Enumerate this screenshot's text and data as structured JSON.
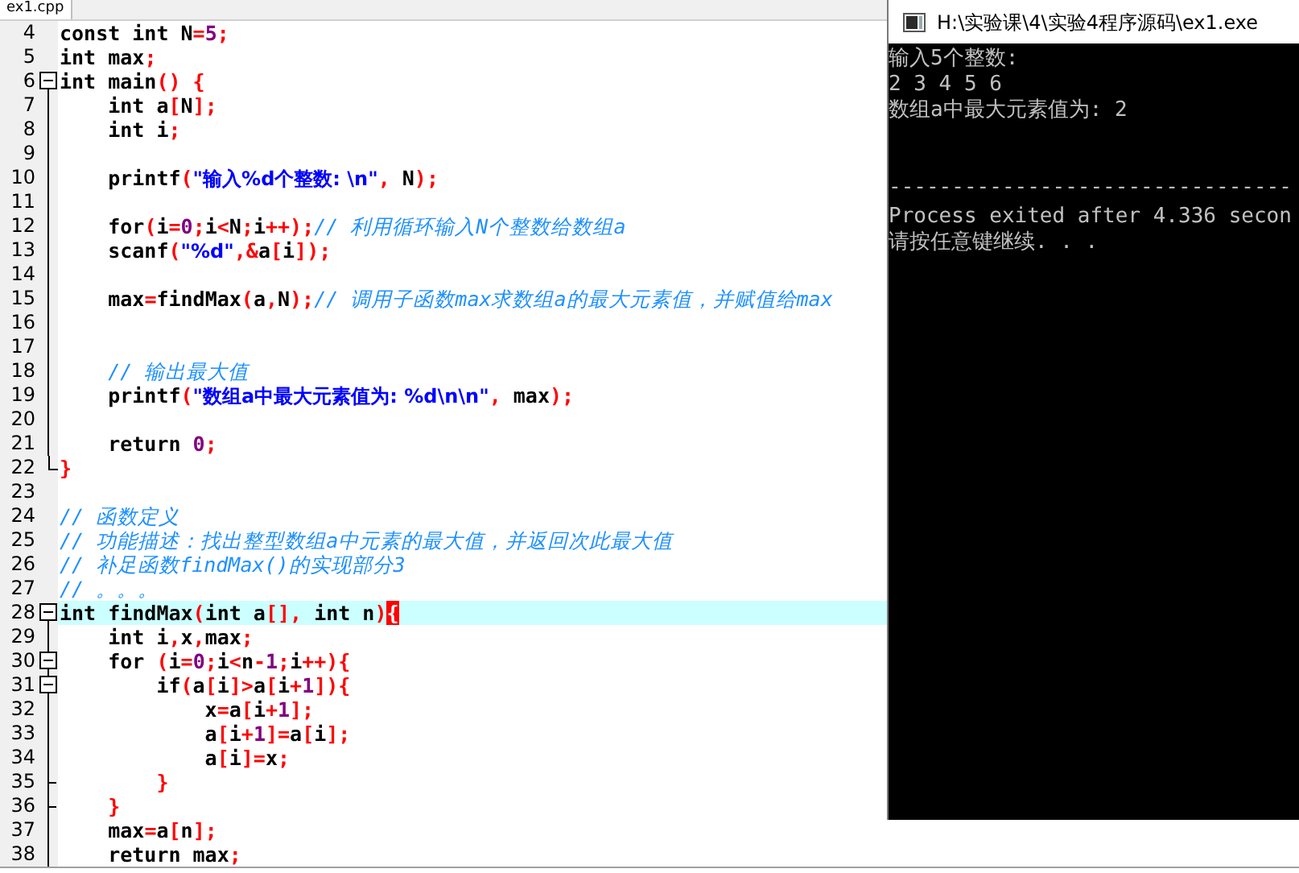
{
  "editor": {
    "tab": {
      "label": "ex1.cpp",
      "selected": true
    },
    "lines": [
      {
        "number": "4",
        "kind": "plain",
        "current": false,
        "tokens": [
          {
            "kind": "code",
            "text": "const int N"
          },
          {
            "kind": "sym",
            "text": "="
          },
          {
            "kind": "num",
            "text": "5"
          },
          {
            "kind": "sym",
            "text": ";"
          }
        ]
      },
      {
        "number": "5",
        "kind": "plain",
        "current": false,
        "tokens": [
          {
            "kind": "code",
            "text": "int max"
          },
          {
            "kind": "sym",
            "text": ";"
          }
        ]
      },
      {
        "number": "6",
        "kind": "fold",
        "current": false,
        "tokens": [
          {
            "kind": "code",
            "text": "int main"
          },
          {
            "kind": "sym",
            "text": "() {"
          }
        ]
      },
      {
        "number": "7",
        "kind": "body",
        "current": false,
        "tokens": [
          {
            "kind": "code",
            "text": "    int a"
          },
          {
            "kind": "sym",
            "text": "["
          },
          {
            "kind": "code",
            "text": "N"
          },
          {
            "kind": "sym",
            "text": "];"
          }
        ]
      },
      {
        "number": "8",
        "kind": "body",
        "current": false,
        "tokens": [
          {
            "kind": "code",
            "text": "    int i"
          },
          {
            "kind": "sym",
            "text": ";"
          }
        ]
      },
      {
        "number": "9",
        "kind": "body",
        "current": false
      },
      {
        "number": "10",
        "kind": "body",
        "current": false,
        "tokens": [
          {
            "kind": "code",
            "text": "    printf"
          },
          {
            "kind": "sym",
            "text": "("
          },
          {
            "kind": "str",
            "text": "\"输入%d个整数: \\n\""
          },
          {
            "kind": "sym",
            "text": ", "
          },
          {
            "kind": "code",
            "text": "N"
          },
          {
            "kind": "sym",
            "text": ");"
          }
        ]
      },
      {
        "number": "11",
        "kind": "body",
        "current": false
      },
      {
        "number": "12",
        "kind": "body",
        "current": false,
        "tokens": [
          {
            "kind": "code",
            "text": "    for"
          },
          {
            "kind": "sym",
            "text": "("
          },
          {
            "kind": "code",
            "text": "i"
          },
          {
            "kind": "sym",
            "text": "="
          },
          {
            "kind": "num",
            "text": "0"
          },
          {
            "kind": "sym",
            "text": ";"
          },
          {
            "kind": "code",
            "text": "i"
          },
          {
            "kind": "sym",
            "text": "<"
          },
          {
            "kind": "code",
            "text": "N"
          },
          {
            "kind": "sym",
            "text": ";"
          },
          {
            "kind": "code",
            "text": "i"
          },
          {
            "kind": "sym",
            "text": "++);"
          },
          {
            "kind": "comment",
            "text": "// 利用循环输入N个整数给数组a"
          }
        ]
      },
      {
        "number": "13",
        "kind": "body",
        "current": false,
        "tokens": [
          {
            "kind": "code",
            "text": "    scanf"
          },
          {
            "kind": "sym",
            "text": "("
          },
          {
            "kind": "str",
            "text": "\"%d\""
          },
          {
            "kind": "sym",
            "text": ",&"
          },
          {
            "kind": "code",
            "text": "a"
          },
          {
            "kind": "sym",
            "text": "["
          },
          {
            "kind": "code",
            "text": "i"
          },
          {
            "kind": "sym",
            "text": "]);"
          }
        ]
      },
      {
        "number": "14",
        "kind": "body",
        "current": false
      },
      {
        "number": "15",
        "kind": "body",
        "current": false,
        "tokens": [
          {
            "kind": "code",
            "text": "    max"
          },
          {
            "kind": "sym",
            "text": "="
          },
          {
            "kind": "code",
            "text": "findMax"
          },
          {
            "kind": "sym",
            "text": "("
          },
          {
            "kind": "code",
            "text": "a"
          },
          {
            "kind": "sym",
            "text": ","
          },
          {
            "kind": "code",
            "text": "N"
          },
          {
            "kind": "sym",
            "text": ");"
          },
          {
            "kind": "comment",
            "text": "// 调用子函数max求数组a的最大元素值，并赋值给max"
          }
        ]
      },
      {
        "number": "16",
        "kind": "body",
        "current": false
      },
      {
        "number": "17",
        "kind": "body",
        "current": false
      },
      {
        "number": "18",
        "kind": "body",
        "current": false,
        "tokens": [
          {
            "kind": "comment",
            "text": "    // 输出最大值"
          }
        ]
      },
      {
        "number": "19",
        "kind": "body",
        "current": false,
        "tokens": [
          {
            "kind": "code",
            "text": "    printf"
          },
          {
            "kind": "sym",
            "text": "("
          },
          {
            "kind": "str",
            "text": "\"数组a中最大元素值为: %d\\n\\n\""
          },
          {
            "kind": "sym",
            "text": ", "
          },
          {
            "kind": "code",
            "text": "max"
          },
          {
            "kind": "sym",
            "text": ");"
          }
        ]
      },
      {
        "number": "20",
        "kind": "body",
        "current": false
      },
      {
        "number": "21",
        "kind": "body",
        "current": false,
        "tokens": [
          {
            "kind": "code",
            "text": "    return "
          },
          {
            "kind": "num",
            "text": "0"
          },
          {
            "kind": "sym",
            "text": ";"
          }
        ]
      },
      {
        "number": "22",
        "kind": "close",
        "current": false,
        "tokens": [
          {
            "kind": "sym",
            "text": "}"
          }
        ]
      },
      {
        "number": "23",
        "kind": "plain",
        "current": false
      },
      {
        "number": "24",
        "kind": "plain",
        "current": false,
        "tokens": [
          {
            "kind": "comment",
            "text": "// 函数定义"
          }
        ]
      },
      {
        "number": "25",
        "kind": "plain",
        "current": false,
        "tokens": [
          {
            "kind": "comment",
            "text": "// 功能描述：找出整型数组a中元素的最大值，并返回次此最大值"
          }
        ]
      },
      {
        "number": "26",
        "kind": "plain",
        "current": false,
        "tokens": [
          {
            "kind": "comment",
            "text": "// 补足函数findMax()的实现部分3"
          }
        ]
      },
      {
        "number": "27",
        "kind": "plain",
        "current": false,
        "tokens": [
          {
            "kind": "comment",
            "text": "// 。。。"
          }
        ]
      },
      {
        "number": "28",
        "kind": "fold",
        "current": true,
        "tokens": [
          {
            "kind": "code",
            "text": "int findMax"
          },
          {
            "kind": "sym",
            "text": "("
          },
          {
            "kind": "code",
            "text": "int a"
          },
          {
            "kind": "sym",
            "text": "[],"
          },
          {
            "kind": "code",
            "text": " int n"
          },
          {
            "kind": "sym",
            "text": ")"
          },
          {
            "kind": "match",
            "text": "{"
          }
        ]
      },
      {
        "number": "29",
        "kind": "body",
        "current": false,
        "tokens": [
          {
            "kind": "code",
            "text": "    int i"
          },
          {
            "kind": "sym",
            "text": ","
          },
          {
            "kind": "code",
            "text": "x"
          },
          {
            "kind": "sym",
            "text": ","
          },
          {
            "kind": "code",
            "text": "max"
          },
          {
            "kind": "sym",
            "text": ";"
          }
        ]
      },
      {
        "number": "30",
        "kind": "nested-fold",
        "current": false,
        "tokens": [
          {
            "kind": "code",
            "text": "    for "
          },
          {
            "kind": "sym",
            "text": "("
          },
          {
            "kind": "code",
            "text": "i"
          },
          {
            "kind": "sym",
            "text": "="
          },
          {
            "kind": "num",
            "text": "0"
          },
          {
            "kind": "sym",
            "text": ";"
          },
          {
            "kind": "code",
            "text": "i"
          },
          {
            "kind": "sym",
            "text": "<"
          },
          {
            "kind": "code",
            "text": "n"
          },
          {
            "kind": "sym",
            "text": "-"
          },
          {
            "kind": "num",
            "text": "1"
          },
          {
            "kind": "sym",
            "text": ";"
          },
          {
            "kind": "code",
            "text": "i"
          },
          {
            "kind": "sym",
            "text": "++){"
          }
        ]
      },
      {
        "number": "31",
        "kind": "nested-fold",
        "current": false,
        "tokens": [
          {
            "kind": "code",
            "text": "        if"
          },
          {
            "kind": "sym",
            "text": "("
          },
          {
            "kind": "code",
            "text": "a"
          },
          {
            "kind": "sym",
            "text": "["
          },
          {
            "kind": "code",
            "text": "i"
          },
          {
            "kind": "sym",
            "text": "]>"
          },
          {
            "kind": "code",
            "text": "a"
          },
          {
            "kind": "sym",
            "text": "["
          },
          {
            "kind": "code",
            "text": "i"
          },
          {
            "kind": "sym",
            "text": "+"
          },
          {
            "kind": "num",
            "text": "1"
          },
          {
            "kind": "sym",
            "text": "]){"
          }
        ]
      },
      {
        "number": "32",
        "kind": "body",
        "current": false,
        "tokens": [
          {
            "kind": "code",
            "text": "            x"
          },
          {
            "kind": "sym",
            "text": "="
          },
          {
            "kind": "code",
            "text": "a"
          },
          {
            "kind": "sym",
            "text": "["
          },
          {
            "kind": "code",
            "text": "i"
          },
          {
            "kind": "sym",
            "text": "+"
          },
          {
            "kind": "num",
            "text": "1"
          },
          {
            "kind": "sym",
            "text": "];"
          }
        ]
      },
      {
        "number": "33",
        "kind": "body",
        "current": false,
        "tokens": [
          {
            "kind": "code",
            "text": "            a"
          },
          {
            "kind": "sym",
            "text": "["
          },
          {
            "kind": "code",
            "text": "i"
          },
          {
            "kind": "sym",
            "text": "+"
          },
          {
            "kind": "num",
            "text": "1"
          },
          {
            "kind": "sym",
            "text": "]="
          },
          {
            "kind": "code",
            "text": "a"
          },
          {
            "kind": "sym",
            "text": "["
          },
          {
            "kind": "code",
            "text": "i"
          },
          {
            "kind": "sym",
            "text": "];"
          }
        ]
      },
      {
        "number": "34",
        "kind": "body",
        "current": false,
        "tokens": [
          {
            "kind": "code",
            "text": "            a"
          },
          {
            "kind": "sym",
            "text": "["
          },
          {
            "kind": "code",
            "text": "i"
          },
          {
            "kind": "sym",
            "text": "]="
          },
          {
            "kind": "code",
            "text": "x"
          },
          {
            "kind": "sym",
            "text": ";"
          }
        ]
      },
      {
        "number": "35",
        "kind": "nested-close",
        "current": false,
        "tokens": [
          {
            "kind": "sym",
            "text": "        }"
          }
        ]
      },
      {
        "number": "36",
        "kind": "nested-close",
        "current": false,
        "tokens": [
          {
            "kind": "sym",
            "text": "    }"
          }
        ]
      },
      {
        "number": "37",
        "kind": "body",
        "current": false,
        "tokens": [
          {
            "kind": "code",
            "text": "    max"
          },
          {
            "kind": "sym",
            "text": "="
          },
          {
            "kind": "code",
            "text": "a"
          },
          {
            "kind": "sym",
            "text": "["
          },
          {
            "kind": "code",
            "text": "n"
          },
          {
            "kind": "sym",
            "text": "];"
          }
        ]
      },
      {
        "number": "38",
        "kind": "body",
        "current": false,
        "tokens": [
          {
            "kind": "code",
            "text": "    return max"
          },
          {
            "kind": "sym",
            "text": ";"
          }
        ]
      }
    ]
  },
  "console": {
    "window": {
      "title": "H:\\实验课\\4\\实验4程序源码\\ex1.exe"
    },
    "output": [
      "输入5个整数:",
      "2 3 4 5 6",
      "数组a中最大元素值为: 2"
    ],
    "separator": "--------------------------------",
    "footer": [
      "Process exited after 4.336 secon",
      "请按任意键继续. . ."
    ]
  }
}
